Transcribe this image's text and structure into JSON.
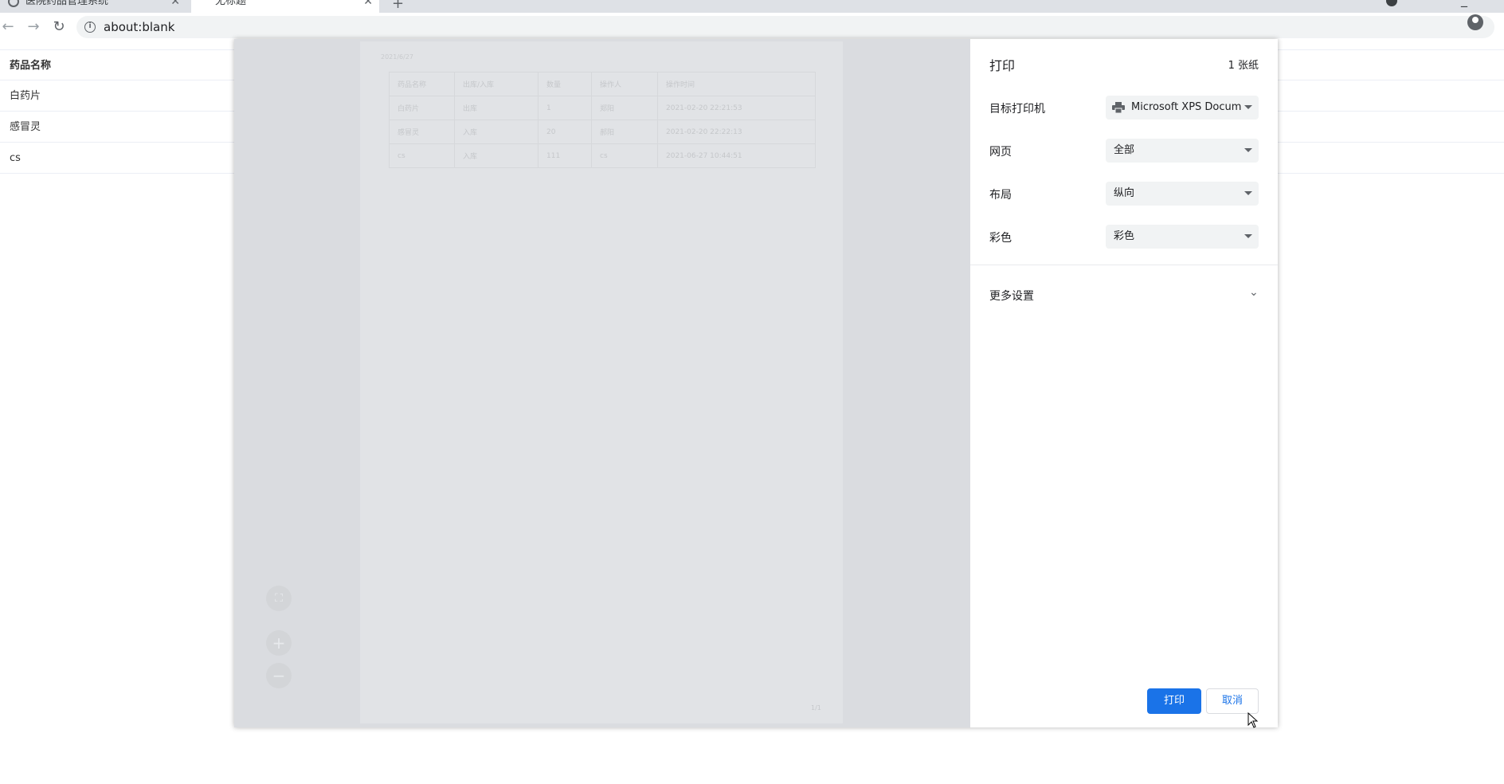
{
  "browser": {
    "tabs": [
      {
        "title": "医院药品管理系统",
        "active": false
      },
      {
        "title": "无标题",
        "active": true
      }
    ],
    "url": "about:blank"
  },
  "page": {
    "table_header": "药品名称",
    "rows": [
      "白药片",
      "感冒灵",
      "cs"
    ]
  },
  "print_dialog": {
    "title": "打印",
    "sheet_count": "1 张纸",
    "settings": [
      {
        "label": "目标打印机",
        "value": "Microsoft XPS Docum",
        "icon": "printer-icon"
      },
      {
        "label": "网页",
        "value": "全部"
      },
      {
        "label": "布局",
        "value": "纵向"
      },
      {
        "label": "彩色",
        "value": "彩色"
      }
    ],
    "more_settings_label": "更多设置",
    "print_button": "打印",
    "cancel_button": "取消",
    "preview": {
      "date": "2021/6/27",
      "headers": [
        "药品名称",
        "出库/入库",
        "数量",
        "操作人",
        "操作时间"
      ],
      "rows": [
        [
          "白药片",
          "出库",
          "1",
          "郑阳",
          "2021-02-20 22:21:53"
        ],
        [
          "感冒灵",
          "入库",
          "20",
          "郝阳",
          "2021-02-20 22:22:13"
        ],
        [
          "cs",
          "入库",
          "111",
          "cs",
          "2021-06-27 10:44:51"
        ]
      ],
      "page_number": "1/1"
    }
  }
}
